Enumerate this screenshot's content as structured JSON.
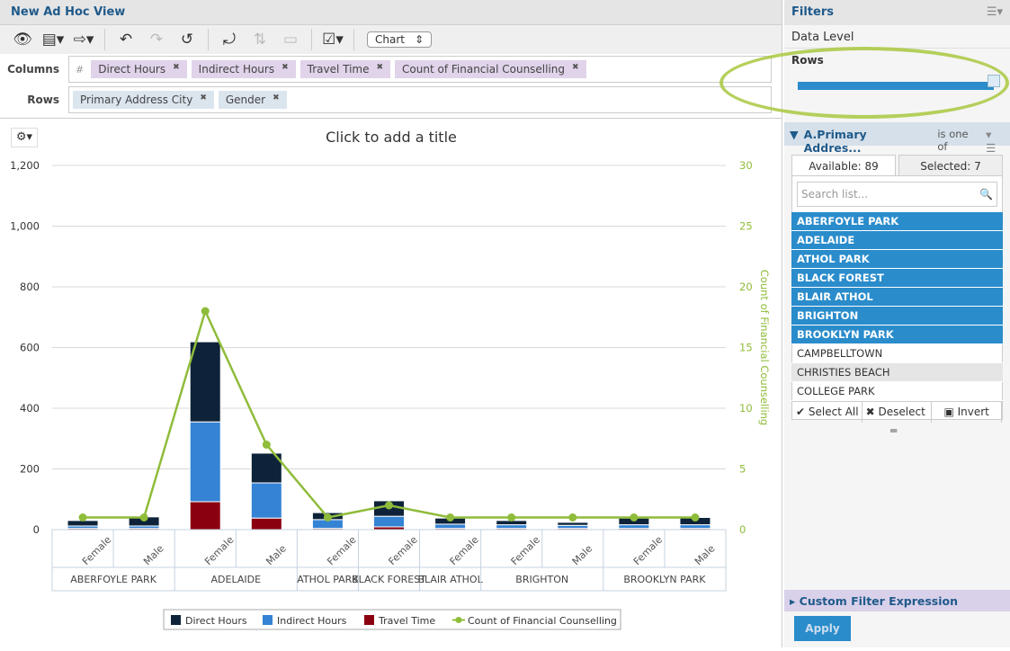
{
  "title": "New Ad Hoc View",
  "toolbar": {
    "chart_select": "Chart",
    "icons": [
      "eye-icon",
      "save-icon",
      "export-icon",
      "undo-icon",
      "redo-icon",
      "reset-icon",
      "switch-axes-icon",
      "sort-icon",
      "table-icon",
      "options-icon"
    ]
  },
  "columns": {
    "label": "Columns",
    "items": [
      "Direct Hours",
      "Indirect Hours",
      "Travel Time",
      "Count of Financial Counselling"
    ]
  },
  "rows": {
    "label": "Rows",
    "items": [
      "Primary Address City",
      "Gender"
    ]
  },
  "chart_title": "Click to add a title",
  "colors": {
    "direct": "#0e2339",
    "indirect": "#3583d4",
    "travel": "#8b0010",
    "count": "#8fbc3a",
    "accent": "#2a8ccb"
  },
  "chart_data": {
    "type": "bar",
    "stacked": true,
    "groups": [
      "ABERFOYLE PARK",
      "ADELAIDE",
      "ATHOL PARK",
      "BLACK FOREST",
      "BLAIR ATHOL",
      "BRIGHTON",
      "BROOKLYN PARK"
    ],
    "group_sizes": [
      2,
      2,
      1,
      1,
      1,
      2,
      2
    ],
    "categories": [
      "Female",
      "Male",
      "Female",
      "Male",
      "Female",
      "Female",
      "Female",
      "Female",
      "Male",
      "Female",
      "Male"
    ],
    "yticks": [
      "0",
      "200",
      "400",
      "600",
      "800",
      "1,000",
      "1,200"
    ],
    "ylim": [
      0,
      1200
    ],
    "y2ticks": [
      "0",
      "5",
      "10",
      "15",
      "20",
      "25",
      "30"
    ],
    "y2lim": [
      0,
      30
    ],
    "y2label": "Count of Financial Counselling",
    "grid": true,
    "legend_position": "bottom",
    "series": [
      {
        "name": "Travel Time",
        "values": [
          4,
          4,
          92,
          38,
          4,
          9,
          4,
          4,
          4,
          4,
          4
        ]
      },
      {
        "name": "Indirect Hours",
        "values": [
          8,
          8,
          263,
          116,
          29,
          35,
          14,
          12,
          10,
          12,
          12
        ]
      },
      {
        "name": "Direct Hours",
        "values": [
          18,
          30,
          264,
          98,
          23,
          51,
          20,
          14,
          10,
          22,
          24
        ]
      },
      {
        "name": "Count of Financial Counselling",
        "type": "line",
        "axis": "right",
        "values": [
          1,
          1,
          18,
          7,
          1,
          2,
          1,
          1,
          1,
          1,
          1
        ]
      }
    ],
    "legend": [
      "Direct Hours",
      "Indirect Hours",
      "Travel Time",
      "Count of Financial Counselling"
    ]
  },
  "filters": {
    "title": "Filters",
    "data_level": "Data Level",
    "rows_label": "Rows",
    "level_value": 1.0,
    "filter_name": "A.Primary Addres...",
    "operator": "is one of",
    "available": "Available: 89",
    "selected": "Selected: 7",
    "search_placeholder": "Search list...",
    "items": [
      {
        "label": "ABERFOYLE PARK",
        "selected": true
      },
      {
        "label": "ADELAIDE",
        "selected": true
      },
      {
        "label": "ATHOL PARK",
        "selected": true
      },
      {
        "label": "BLACK FOREST",
        "selected": true
      },
      {
        "label": "BLAIR ATHOL",
        "selected": true
      },
      {
        "label": "BRIGHTON",
        "selected": true
      },
      {
        "label": "BROOKLYN PARK",
        "selected": true
      },
      {
        "label": "CAMPBELLTOWN",
        "selected": false
      },
      {
        "label": "CHRISTIES BEACH",
        "selected": false
      },
      {
        "label": "COLLEGE PARK",
        "selected": false
      }
    ],
    "select_all": "Select All",
    "deselect": "Deselect",
    "invert": "Invert",
    "custom": "Custom Filter Expression",
    "apply": "Apply"
  }
}
